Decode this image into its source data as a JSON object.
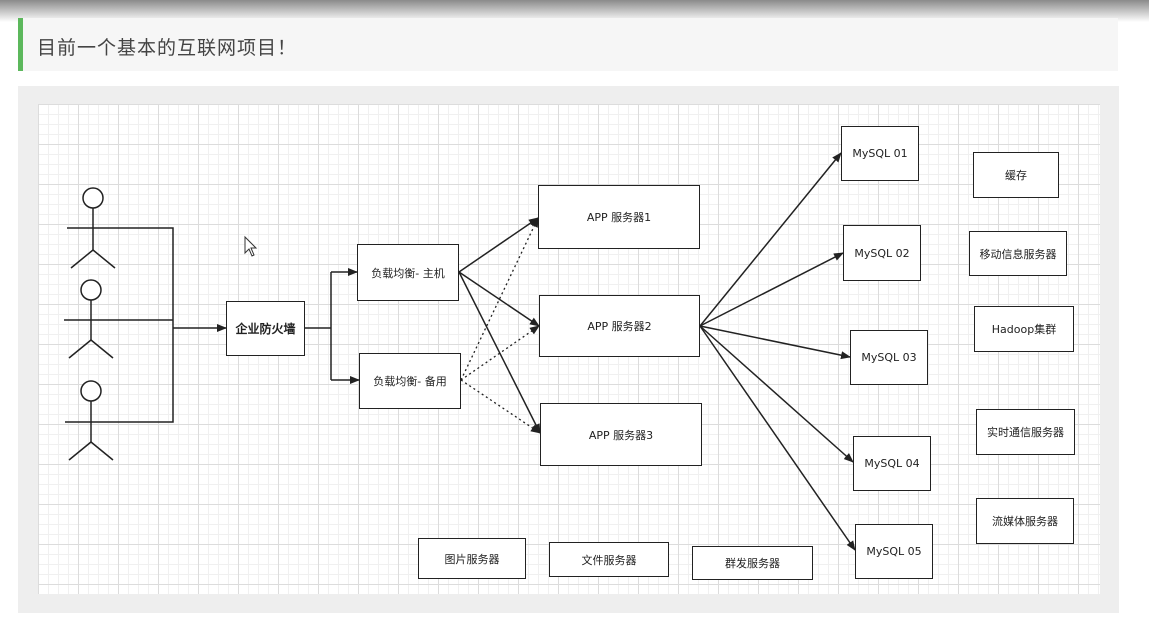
{
  "header": {
    "title": "目前一个基本的互联网项目！"
  },
  "firewall": {
    "label": "企业防火墙"
  },
  "load_balancers": {
    "primary": "负载均衡- 主机",
    "backup": "负载均衡- 备用"
  },
  "app_servers": [
    "APP 服务器1",
    "APP 服务器2",
    "APP 服务器3"
  ],
  "mysql": [
    "MySQL 01",
    "MySQL 02",
    "MySQL 03",
    "MySQL 04",
    "MySQL 05"
  ],
  "services": [
    "缓存",
    "移动信息服务器",
    "Hadoop集群",
    "实时通信服务器",
    "流媒体服务器"
  ],
  "bottom_servers": [
    "图片服务器",
    "文件服务器",
    "群发服务器"
  ],
  "colors": {
    "accent": "#5cb85c",
    "line": "#222222"
  }
}
